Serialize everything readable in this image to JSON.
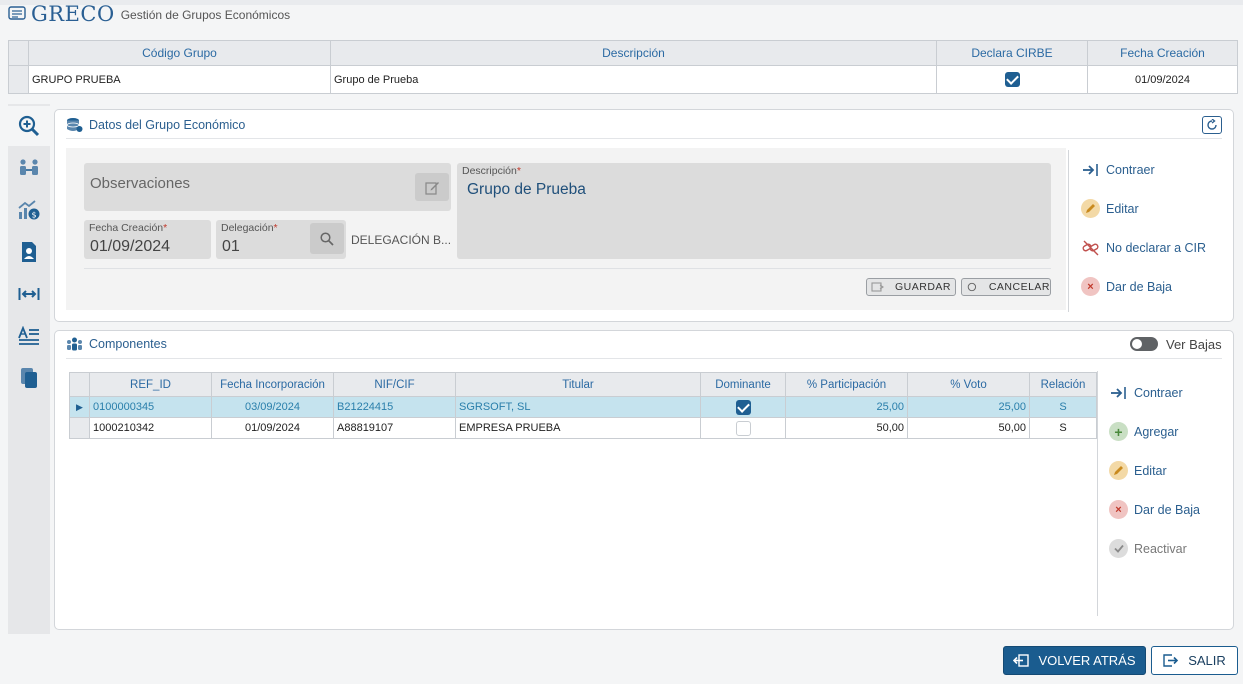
{
  "app": {
    "title": "GRECO",
    "subtitle": "Gestión de Grupos Económicos"
  },
  "group_grid": {
    "columns": [
      "Código Grupo",
      "Descripción",
      "Declara CIRBE",
      "Fecha Creación"
    ],
    "row": {
      "codigo": "GRUPO PRUEBA",
      "descripcion": "Grupo de Prueba",
      "declara_cirbe": true,
      "fecha": "01/09/2024"
    }
  },
  "datos": {
    "title": "Datos del Grupo Económico",
    "observaciones_placeholder": "Observaciones",
    "descripcion_label": "Descripción",
    "descripcion_value": "Grupo de Prueba",
    "fecha_label": "Fecha Creación",
    "fecha_value": "01/09/2024",
    "delegacion_label": "Delegación",
    "delegacion_value": "01",
    "delegacion_name": "DELEGACIÓN B...",
    "required_mark": "*",
    "guardar_label": "GUARDAR",
    "cancelar_label": "CANCELAR",
    "actions": {
      "contraer": "Contraer",
      "editar": "Editar",
      "no_declarar": "No declarar a CIR",
      "dar_baja": "Dar de Baja"
    }
  },
  "componentes": {
    "title": "Componentes",
    "ver_bajas": "Ver Bajas",
    "ver_bajas_on": false,
    "columns": [
      "REF_ID",
      "Fecha Incorporación",
      "NIF/CIF",
      "Titular",
      "Dominante",
      "% Participación",
      "% Voto",
      "Relación"
    ],
    "rows": [
      {
        "ref_id": "0100000345",
        "fecha": "03/09/2024",
        "nif": "B21224415",
        "titular": "SGRSOFT, SL",
        "dominante": true,
        "participacion": "25,00",
        "voto": "25,00",
        "relacion": "S"
      },
      {
        "ref_id": "1000210342",
        "fecha": "01/09/2024",
        "nif": "A88819107",
        "titular": "EMPRESA PRUEBA",
        "dominante": false,
        "participacion": "50,00",
        "voto": "50,00",
        "relacion": "S"
      }
    ],
    "actions": {
      "contraer": "Contraer",
      "agregar": "Agregar",
      "editar": "Editar",
      "dar_baja": "Dar de Baja",
      "reactivar": "Reactivar"
    }
  },
  "footer": {
    "volver": "VOLVER ATRÁS",
    "salir": "SALIR"
  },
  "colors": {
    "accent": "#2b5f8f",
    "primary_button": "#1a5c8f",
    "selected_row": "#c5e3ee"
  }
}
